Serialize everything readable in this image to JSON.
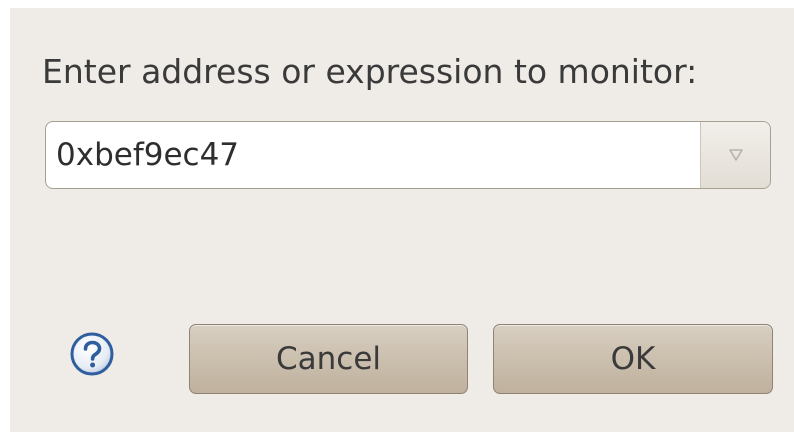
{
  "dialog": {
    "prompt_label": "Enter address or expression to monitor:",
    "expression_value": "0xbef9ec47"
  },
  "buttons": {
    "cancel_label": "Cancel",
    "ok_label": "OK"
  },
  "icons": {
    "help": "help-question-icon",
    "dropdown": "chevron-down-icon"
  },
  "colors": {
    "dialog_background": "#efebe7",
    "button_background": "#cbbfae",
    "help_icon_blue": "#2f5e9e"
  }
}
